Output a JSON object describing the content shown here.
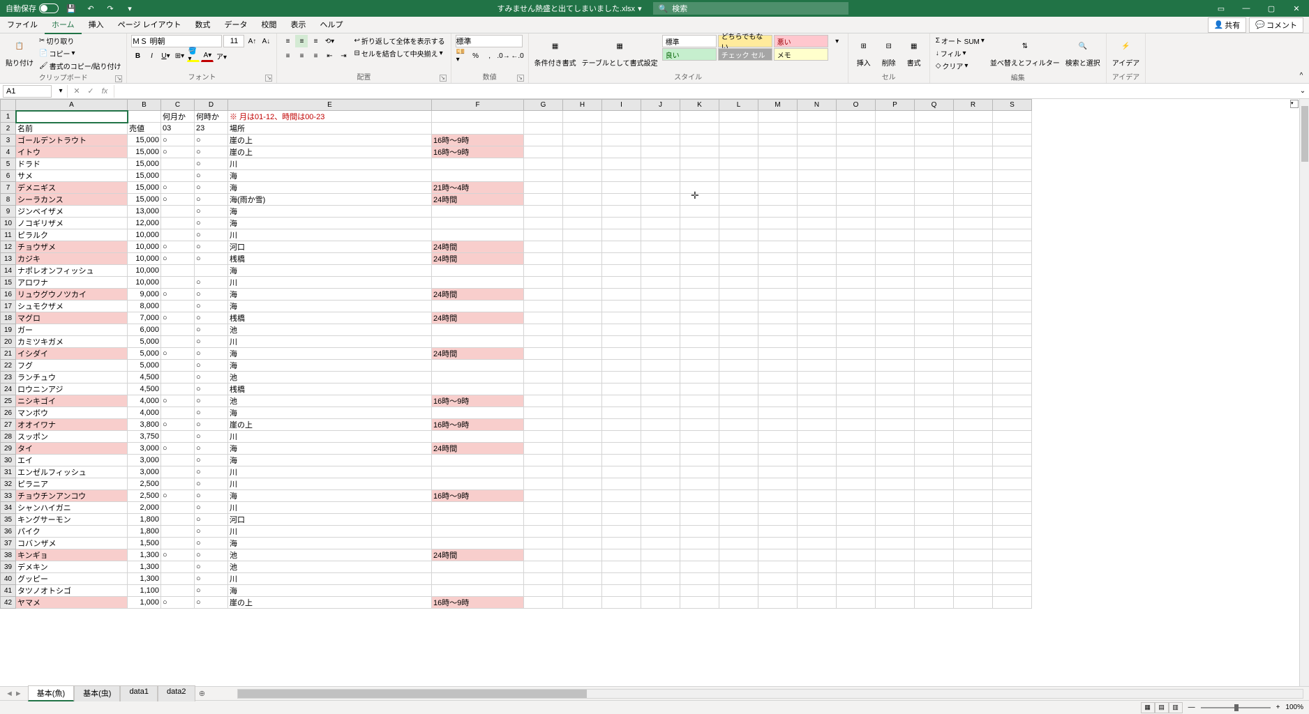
{
  "titlebar": {
    "autosave_label": "自動保存",
    "autosave_state": "オフ",
    "filename": "すみません熱盛と出てしまいました.xlsx",
    "search_placeholder": "検索"
  },
  "menu": {
    "tabs": [
      "ファイル",
      "ホーム",
      "挿入",
      "ページ レイアウト",
      "数式",
      "データ",
      "校閲",
      "表示",
      "ヘルプ"
    ],
    "share": "共有",
    "comment": "コメント"
  },
  "ribbon": {
    "clipboard": {
      "paste": "貼り付け",
      "cut": "切り取り",
      "copy": "コピー",
      "format_painter": "書式のコピー/貼り付け",
      "label": "クリップボード"
    },
    "font": {
      "name": "ＭＳ 明朝",
      "size": "11",
      "label": "フォント"
    },
    "alignment": {
      "wrap": "折り返して全体を表示する",
      "merge": "セルを結合して中央揃え",
      "label": "配置"
    },
    "number": {
      "format": "標準",
      "label": "数値"
    },
    "styles": {
      "cond_format": "条件付き書式",
      "table_format": "テーブルとして書式設定",
      "cells": [
        "標準",
        "どちらでもない",
        "悪い",
        "良い",
        "チェック セル",
        "メモ"
      ],
      "label": "スタイル"
    },
    "cells_grp": {
      "insert": "挿入",
      "delete": "削除",
      "format": "書式",
      "label": "セル"
    },
    "editing": {
      "autosum": "オート SUM",
      "fill": "フィル",
      "clear": "クリア",
      "sort": "並べ替えとフィルター",
      "find": "検索と選択",
      "label": "編集"
    },
    "ideas": {
      "btn": "アイデア",
      "label": "アイデア"
    }
  },
  "namebox": "A1",
  "headers": {
    "row1": {
      "C": "何月か",
      "D": "何時か",
      "E": "※ 月は01-12、時間は00-23"
    },
    "row2": {
      "A": "名前",
      "B": "売値",
      "C": "03",
      "D": "23",
      "E": "場所"
    }
  },
  "cols": [
    "A",
    "B",
    "C",
    "D",
    "E",
    "F",
    "G",
    "H",
    "I",
    "J",
    "K",
    "L",
    "M",
    "N",
    "O",
    "P",
    "Q",
    "R",
    "S"
  ],
  "rows": [
    {
      "n": 3,
      "hi": true,
      "a": "ゴールデントラウト",
      "b": "15,000",
      "c": "○",
      "d": "○",
      "e": "崖の上",
      "f": "16時～9時"
    },
    {
      "n": 4,
      "hi": true,
      "a": "イトウ",
      "b": "15,000",
      "c": "○",
      "d": "○",
      "e": "崖の上",
      "f": "16時～9時"
    },
    {
      "n": 5,
      "a": "ドラド",
      "b": "15,000",
      "c": "",
      "d": "○",
      "e": "川",
      "f": ""
    },
    {
      "n": 6,
      "a": "サメ",
      "b": "15,000",
      "c": "",
      "d": "○",
      "e": "海",
      "f": ""
    },
    {
      "n": 7,
      "hi": true,
      "a": "デメニギス",
      "b": "15,000",
      "c": "○",
      "d": "○",
      "e": "海",
      "f": "21時～4時"
    },
    {
      "n": 8,
      "hi": true,
      "a": "シーラカンス",
      "b": "15,000",
      "c": "○",
      "d": "○",
      "e": "海(雨か雪)",
      "f": "24時間"
    },
    {
      "n": 9,
      "a": "ジンベイザメ",
      "b": "13,000",
      "c": "",
      "d": "○",
      "e": "海",
      "f": ""
    },
    {
      "n": 10,
      "a": "ノコギリザメ",
      "b": "12,000",
      "c": "",
      "d": "○",
      "e": "海",
      "f": ""
    },
    {
      "n": 11,
      "a": "ピラルク",
      "b": "10,000",
      "c": "",
      "d": "○",
      "e": "川",
      "f": ""
    },
    {
      "n": 12,
      "hi": true,
      "a": "チョウザメ",
      "b": "10,000",
      "c": "○",
      "d": "○",
      "e": "河口",
      "f": "24時間"
    },
    {
      "n": 13,
      "hi": true,
      "a": "カジキ",
      "b": "10,000",
      "c": "○",
      "d": "○",
      "e": "桟橋",
      "f": "24時間"
    },
    {
      "n": 14,
      "a": "ナポレオンフィッシュ",
      "b": "10,000",
      "c": "",
      "d": "",
      "e": "海",
      "f": ""
    },
    {
      "n": 15,
      "a": "アロワナ",
      "b": "10,000",
      "c": "",
      "d": "○",
      "e": "川",
      "f": ""
    },
    {
      "n": 16,
      "hi": true,
      "a": "リュウグウノツカイ",
      "b": "9,000",
      "c": "○",
      "d": "○",
      "e": "海",
      "f": "24時間"
    },
    {
      "n": 17,
      "a": "シュモクザメ",
      "b": "8,000",
      "c": "",
      "d": "○",
      "e": "海",
      "f": ""
    },
    {
      "n": 18,
      "hi": true,
      "a": "マグロ",
      "b": "7,000",
      "c": "○",
      "d": "○",
      "e": "桟橋",
      "f": "24時間"
    },
    {
      "n": 19,
      "a": "ガー",
      "b": "6,000",
      "c": "",
      "d": "○",
      "e": "池",
      "f": ""
    },
    {
      "n": 20,
      "a": "カミツキガメ",
      "b": "5,000",
      "c": "",
      "d": "○",
      "e": "川",
      "f": ""
    },
    {
      "n": 21,
      "hi": true,
      "a": "イシダイ",
      "b": "5,000",
      "c": "○",
      "d": "○",
      "e": "海",
      "f": "24時間"
    },
    {
      "n": 22,
      "a": "フグ",
      "b": "5,000",
      "c": "",
      "d": "○",
      "e": "海",
      "f": ""
    },
    {
      "n": 23,
      "a": "ランチュウ",
      "b": "4,500",
      "c": "",
      "d": "○",
      "e": "池",
      "f": ""
    },
    {
      "n": 24,
      "a": "ロウニンアジ",
      "b": "4,500",
      "c": "",
      "d": "○",
      "e": "桟橋",
      "f": ""
    },
    {
      "n": 25,
      "hi": true,
      "a": "ニシキゴイ",
      "b": "4,000",
      "c": "○",
      "d": "○",
      "e": "池",
      "f": "16時～9時"
    },
    {
      "n": 26,
      "a": "マンボウ",
      "b": "4,000",
      "c": "",
      "d": "○",
      "e": "海",
      "f": ""
    },
    {
      "n": 27,
      "hi": true,
      "a": "オオイワナ",
      "b": "3,800",
      "c": "○",
      "d": "○",
      "e": "崖の上",
      "f": "16時～9時"
    },
    {
      "n": 28,
      "a": "スッポン",
      "b": "3,750",
      "c": "",
      "d": "○",
      "e": "川",
      "f": ""
    },
    {
      "n": 29,
      "hi": true,
      "a": "タイ",
      "b": "3,000",
      "c": "○",
      "d": "○",
      "e": "海",
      "f": "24時間"
    },
    {
      "n": 30,
      "a": "エイ",
      "b": "3,000",
      "c": "",
      "d": "○",
      "e": "海",
      "f": ""
    },
    {
      "n": 31,
      "a": "エンゼルフィッシュ",
      "b": "3,000",
      "c": "",
      "d": "○",
      "e": "川",
      "f": ""
    },
    {
      "n": 32,
      "a": "ピラニア",
      "b": "2,500",
      "c": "",
      "d": "○",
      "e": "川",
      "f": ""
    },
    {
      "n": 33,
      "hi": true,
      "a": "チョウチンアンコウ",
      "b": "2,500",
      "c": "○",
      "d": "○",
      "e": "海",
      "f": "16時～9時"
    },
    {
      "n": 34,
      "a": "シャンハイガニ",
      "b": "2,000",
      "c": "",
      "d": "○",
      "e": "川",
      "f": ""
    },
    {
      "n": 35,
      "a": "キングサーモン",
      "b": "1,800",
      "c": "",
      "d": "○",
      "e": "河口",
      "f": ""
    },
    {
      "n": 36,
      "a": "パイク",
      "b": "1,800",
      "c": "",
      "d": "○",
      "e": "川",
      "f": ""
    },
    {
      "n": 37,
      "a": "コバンザメ",
      "b": "1,500",
      "c": "",
      "d": "○",
      "e": "海",
      "f": ""
    },
    {
      "n": 38,
      "hi": true,
      "a": "キンギョ",
      "b": "1,300",
      "c": "○",
      "d": "○",
      "e": "池",
      "f": "24時間"
    },
    {
      "n": 39,
      "a": "デメキン",
      "b": "1,300",
      "c": "",
      "d": "○",
      "e": "池",
      "f": ""
    },
    {
      "n": 40,
      "a": "グッピー",
      "b": "1,300",
      "c": "",
      "d": "○",
      "e": "川",
      "f": ""
    },
    {
      "n": 41,
      "a": "タツノオトシゴ",
      "b": "1,100",
      "c": "",
      "d": "○",
      "e": "海",
      "f": ""
    },
    {
      "n": 42,
      "hi": true,
      "a": "ヤマメ",
      "b": "1,000",
      "c": "○",
      "d": "○",
      "e": "崖の上",
      "f": "16時～9時"
    }
  ],
  "sheets": [
    "基本(魚)",
    "基本(虫)",
    "data1",
    "data2"
  ],
  "status": {
    "zoom": "100%"
  }
}
